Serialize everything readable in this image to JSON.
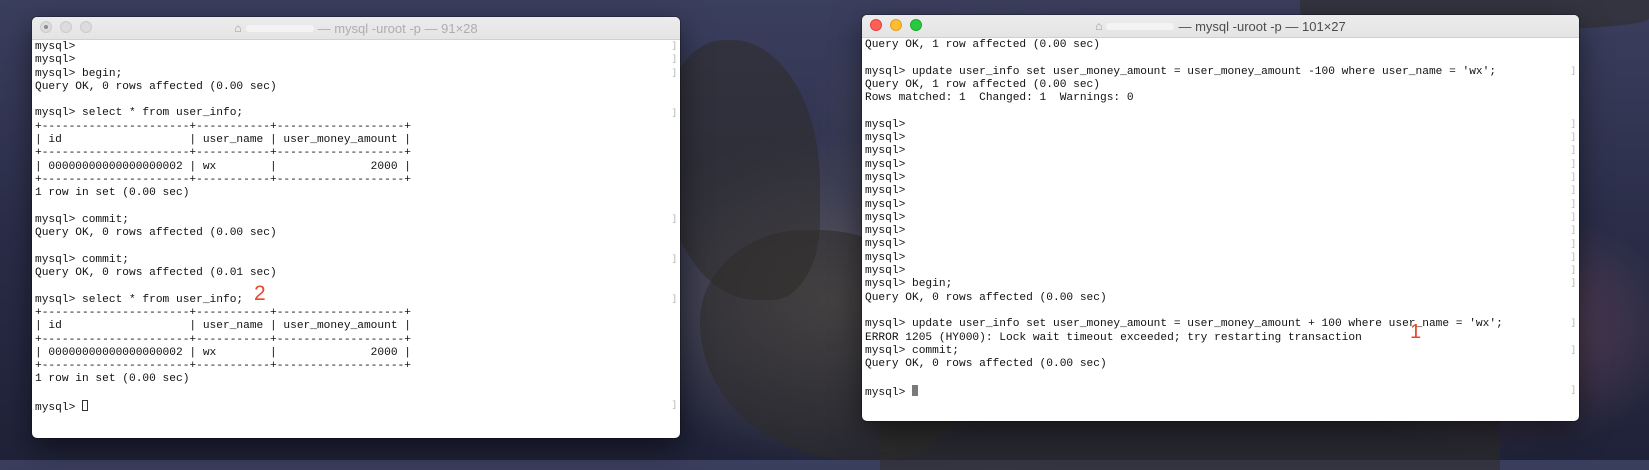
{
  "desktop": {
    "background": "macOS Catalina island wallpaper"
  },
  "windows": {
    "left": {
      "title": "— mysql -uroot -p — 91×28",
      "lines": [
        "mysql>",
        "mysql>",
        "mysql> begin;",
        "Query OK, 0 rows affected (0.00 sec)",
        "",
        "mysql> select * from user_info;",
        "+----------------------+-----------+-------------------+",
        "| id                   | user_name | user_money_amount |",
        "+----------------------+-----------+-------------------+",
        "| 00000000000000000002 | wx        |              2000 |",
        "+----------------------+-----------+-------------------+",
        "1 row in set (0.00 sec)",
        "",
        "mysql> commit;",
        "Query OK, 0 rows affected (0.00 sec)",
        "",
        "mysql> commit;",
        "Query OK, 0 rows affected (0.01 sec)",
        "",
        "mysql> select * from user_info;",
        "+----------------------+-----------+-------------------+",
        "| id                   | user_name | user_money_amount |",
        "+----------------------+-----------+-------------------+",
        "| 00000000000000000002 | wx        |              2000 |",
        "+----------------------+-----------+-------------------+",
        "1 row in set (0.00 sec)",
        "",
        "mysql> "
      ],
      "annotation": "2"
    },
    "right": {
      "title": "— mysql -uroot -p — 101×27",
      "lines": [
        "Query OK, 1 row affected (0.00 sec)",
        "",
        "mysql> update user_info set user_money_amount = user_money_amount -100 where user_name = 'wx';",
        "Query OK, 1 row affected (0.00 sec)",
        "Rows matched: 1  Changed: 1  Warnings: 0",
        "",
        "mysql>",
        "mysql>",
        "mysql>",
        "mysql>",
        "mysql>",
        "mysql>",
        "mysql>",
        "mysql>",
        "mysql>",
        "mysql>",
        "mysql>",
        "mysql>",
        "mysql> begin;",
        "Query OK, 0 rows affected (0.00 sec)",
        "",
        "mysql> update user_info set user_money_amount = user_money_amount + 100 where user_name = 'wx';",
        "ERROR 1205 (HY000): Lock wait timeout exceeded; try restarting transaction",
        "mysql> commit;",
        "Query OK, 0 rows affected (0.00 sec)",
        "",
        "mysql> "
      ],
      "annotation": "1"
    }
  }
}
